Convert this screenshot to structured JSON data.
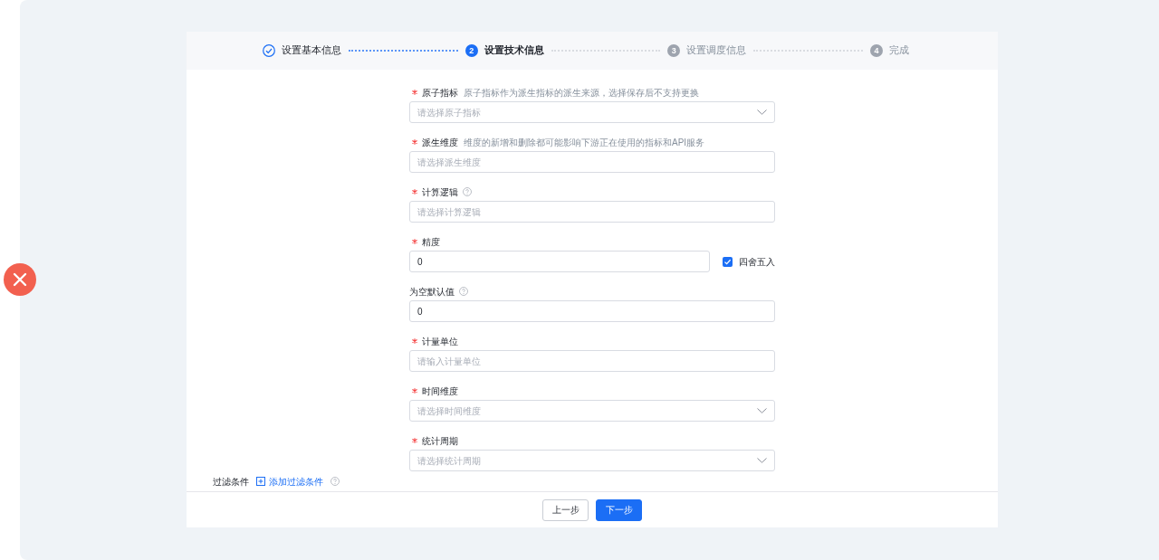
{
  "steps": [
    {
      "label": "设置基本信息",
      "completed": true,
      "selected": false
    },
    {
      "number": "2",
      "label": "设置技术信息",
      "completed": false,
      "selected": true
    },
    {
      "number": "3",
      "label": "设置调度信息",
      "completed": false,
      "selected": false
    },
    {
      "number": "4",
      "label": "完成",
      "completed": false,
      "selected": false
    }
  ],
  "fields": [
    {
      "kind": "select",
      "required": true,
      "label": "原子指标",
      "hint": "原子指标作为派生指标的派生来源，选择保存后不支持更换",
      "help": false,
      "placeholder": "请选择原子指标"
    },
    {
      "kind": "input",
      "required": true,
      "label": "派生维度",
      "hint": "维度的新增和删除都可能影响下游正在使用的指标和API服务",
      "help": false,
      "placeholder": "请选择派生维度"
    },
    {
      "kind": "input",
      "required": true,
      "label": "计算逻辑",
      "help": true,
      "placeholder": "请选择计算逻辑"
    },
    {
      "kind": "input",
      "required": true,
      "label": "精度",
      "help": false,
      "value": "0",
      "checkbox": {
        "label": "四舍五入",
        "checked": true
      }
    },
    {
      "kind": "input",
      "required": false,
      "label": "为空默认值",
      "help": true,
      "value": "0"
    },
    {
      "kind": "input",
      "required": true,
      "label": "计量单位",
      "help": false,
      "placeholder": "请输入计量单位"
    },
    {
      "kind": "select",
      "required": true,
      "label": "时间维度",
      "help": false,
      "placeholder": "请选择时间维度"
    },
    {
      "kind": "select",
      "required": true,
      "label": "统计周期",
      "help": false,
      "placeholder": "请选择统计周期"
    }
  ],
  "filter": {
    "label": "过滤条件",
    "link": "添加过滤条件",
    "help": true
  },
  "footer": {
    "buttons": [
      {
        "label": "上一步",
        "kind": "secondary"
      },
      {
        "label": "下一步",
        "kind": "primary"
      }
    ]
  }
}
